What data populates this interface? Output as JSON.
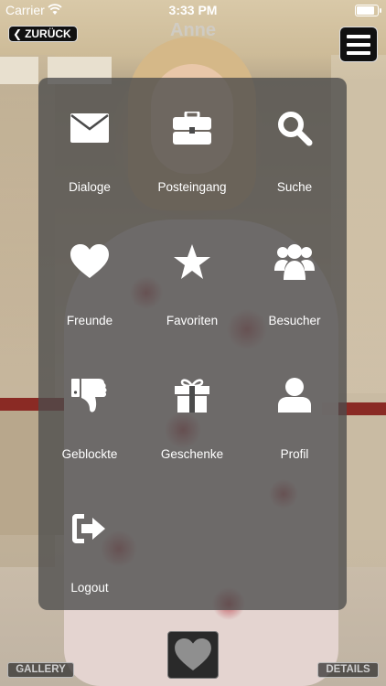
{
  "status_bar": {
    "carrier": "Carrier",
    "time": "3:33 PM",
    "battery_level": 0.95
  },
  "header": {
    "back_label": "ZURÜCK",
    "title": "Anne",
    "menu_icon": "hamburger-menu-icon"
  },
  "menu": {
    "items": [
      {
        "label": "Dialoge",
        "icon": "envelope-icon"
      },
      {
        "label": "Posteingang",
        "icon": "briefcase-icon"
      },
      {
        "label": "Suche",
        "icon": "search-icon"
      },
      {
        "label": "Freunde",
        "icon": "heart-icon"
      },
      {
        "label": "Favoriten",
        "icon": "star-icon"
      },
      {
        "label": "Besucher",
        "icon": "users-icon"
      },
      {
        "label": "Geblockte",
        "icon": "thumbs-down-icon"
      },
      {
        "label": "Geschenke",
        "icon": "gift-icon"
      },
      {
        "label": "Profil",
        "icon": "user-icon"
      },
      {
        "label": "Logout",
        "icon": "sign-out-icon"
      }
    ]
  },
  "footer": {
    "gallery_label": "GALLERY",
    "details_label": "DETAILS",
    "like_icon": "heart-icon"
  },
  "colors": {
    "panel": "#4b4b4b",
    "icon": "#ffffff",
    "button_bg": "#111111"
  }
}
